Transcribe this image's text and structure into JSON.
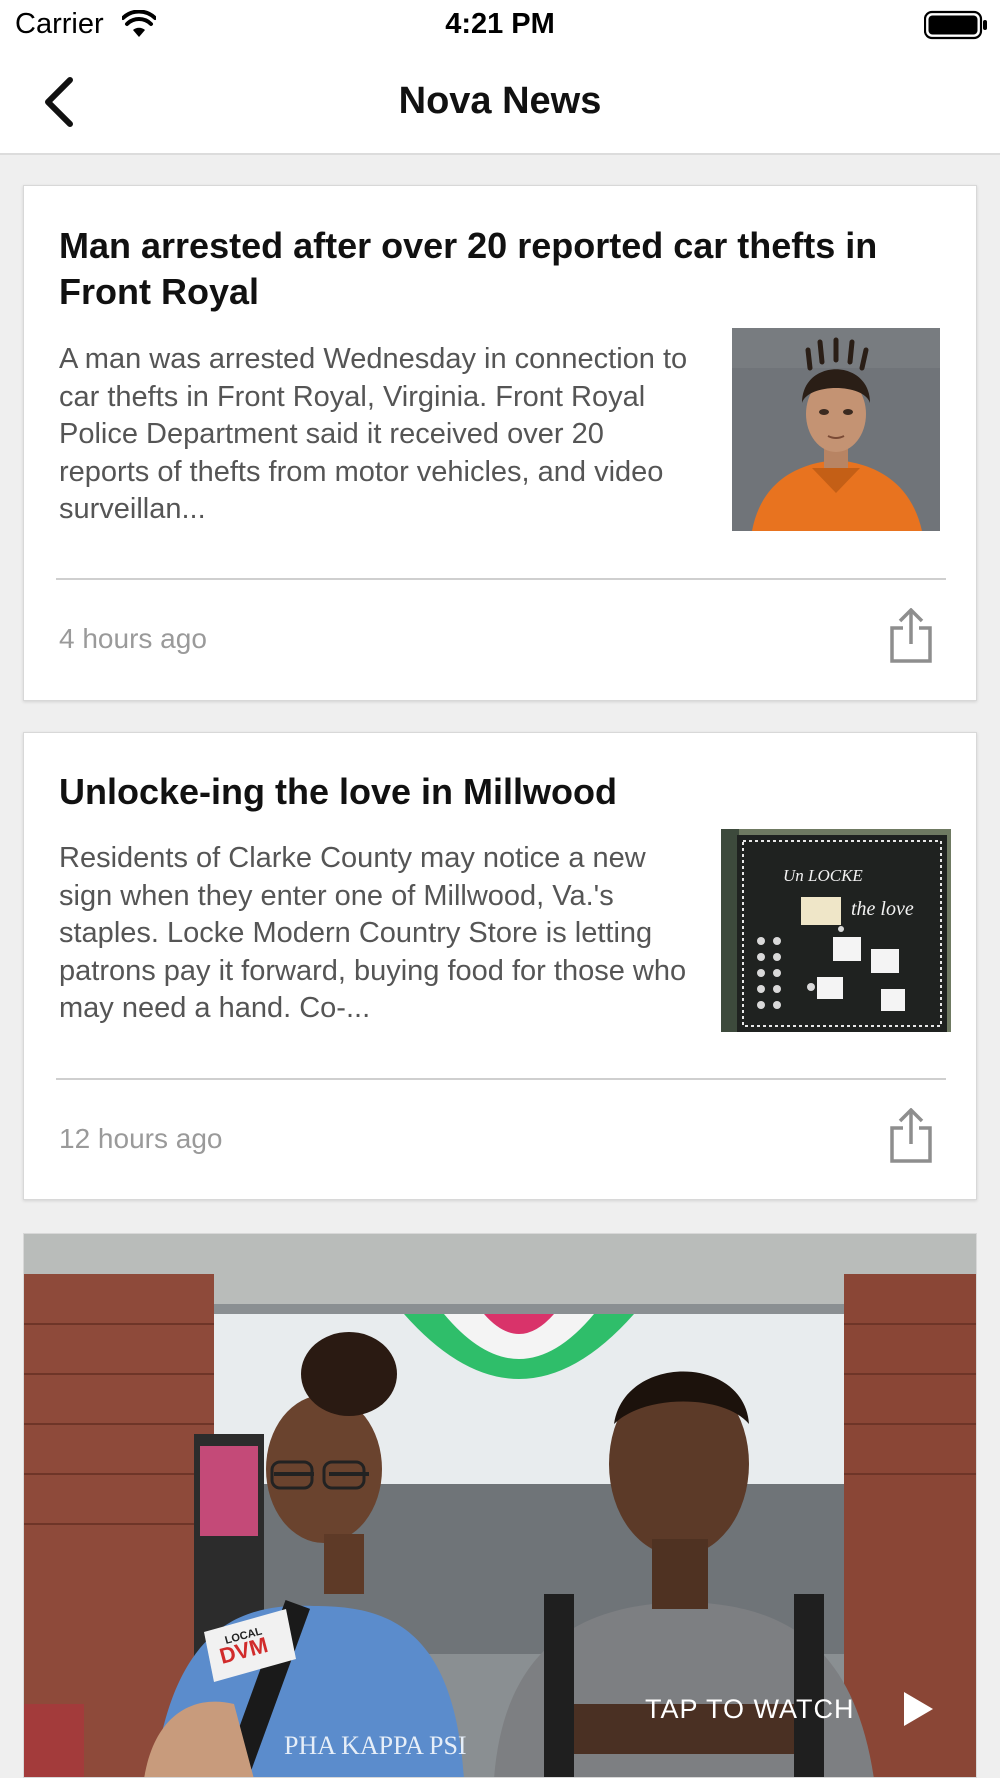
{
  "status_bar": {
    "carrier": "Carrier",
    "time": "4:21 PM"
  },
  "nav": {
    "title": "Nova News",
    "back_icon": "chevron-left-icon"
  },
  "articles": [
    {
      "headline": "Man arrested after over 20 reported car thefts in Front Royal",
      "summary": "A man was arrested Wednesday in connection to car thefts in Front Royal, Virginia. Front Royal Police Department said it received over 20 reports of thefts from motor vehicles, and video surveillan...",
      "time": "4 hours ago",
      "share_icon": "share-icon"
    },
    {
      "headline": "Unlocke-ing the love in Millwood",
      "summary": "Residents of Clarke County may notice a new sign when they enter one of Millwood, Va.'s staples. Locke Modern Country Store is letting patrons pay it forward, buying food for those who may need a hand. Co-...",
      "time": "12 hours ago",
      "share_icon": "share-icon",
      "thumb_sign_line1": "Un LOCKE",
      "thumb_sign_line2": "the love"
    }
  ],
  "video": {
    "cta": "TAP TO WATCH",
    "mic_flag_line1": "LOCAL",
    "mic_flag_line2": "DVM",
    "shirt_text": "PHA KAPPA PSI",
    "play_icon": "play-icon"
  },
  "colors": {
    "background": "#efefef",
    "card": "#ffffff",
    "headline": "#111111",
    "summary": "#555555",
    "timestamp": "#9a9a9a",
    "icon_gray": "#8e8e8e"
  }
}
